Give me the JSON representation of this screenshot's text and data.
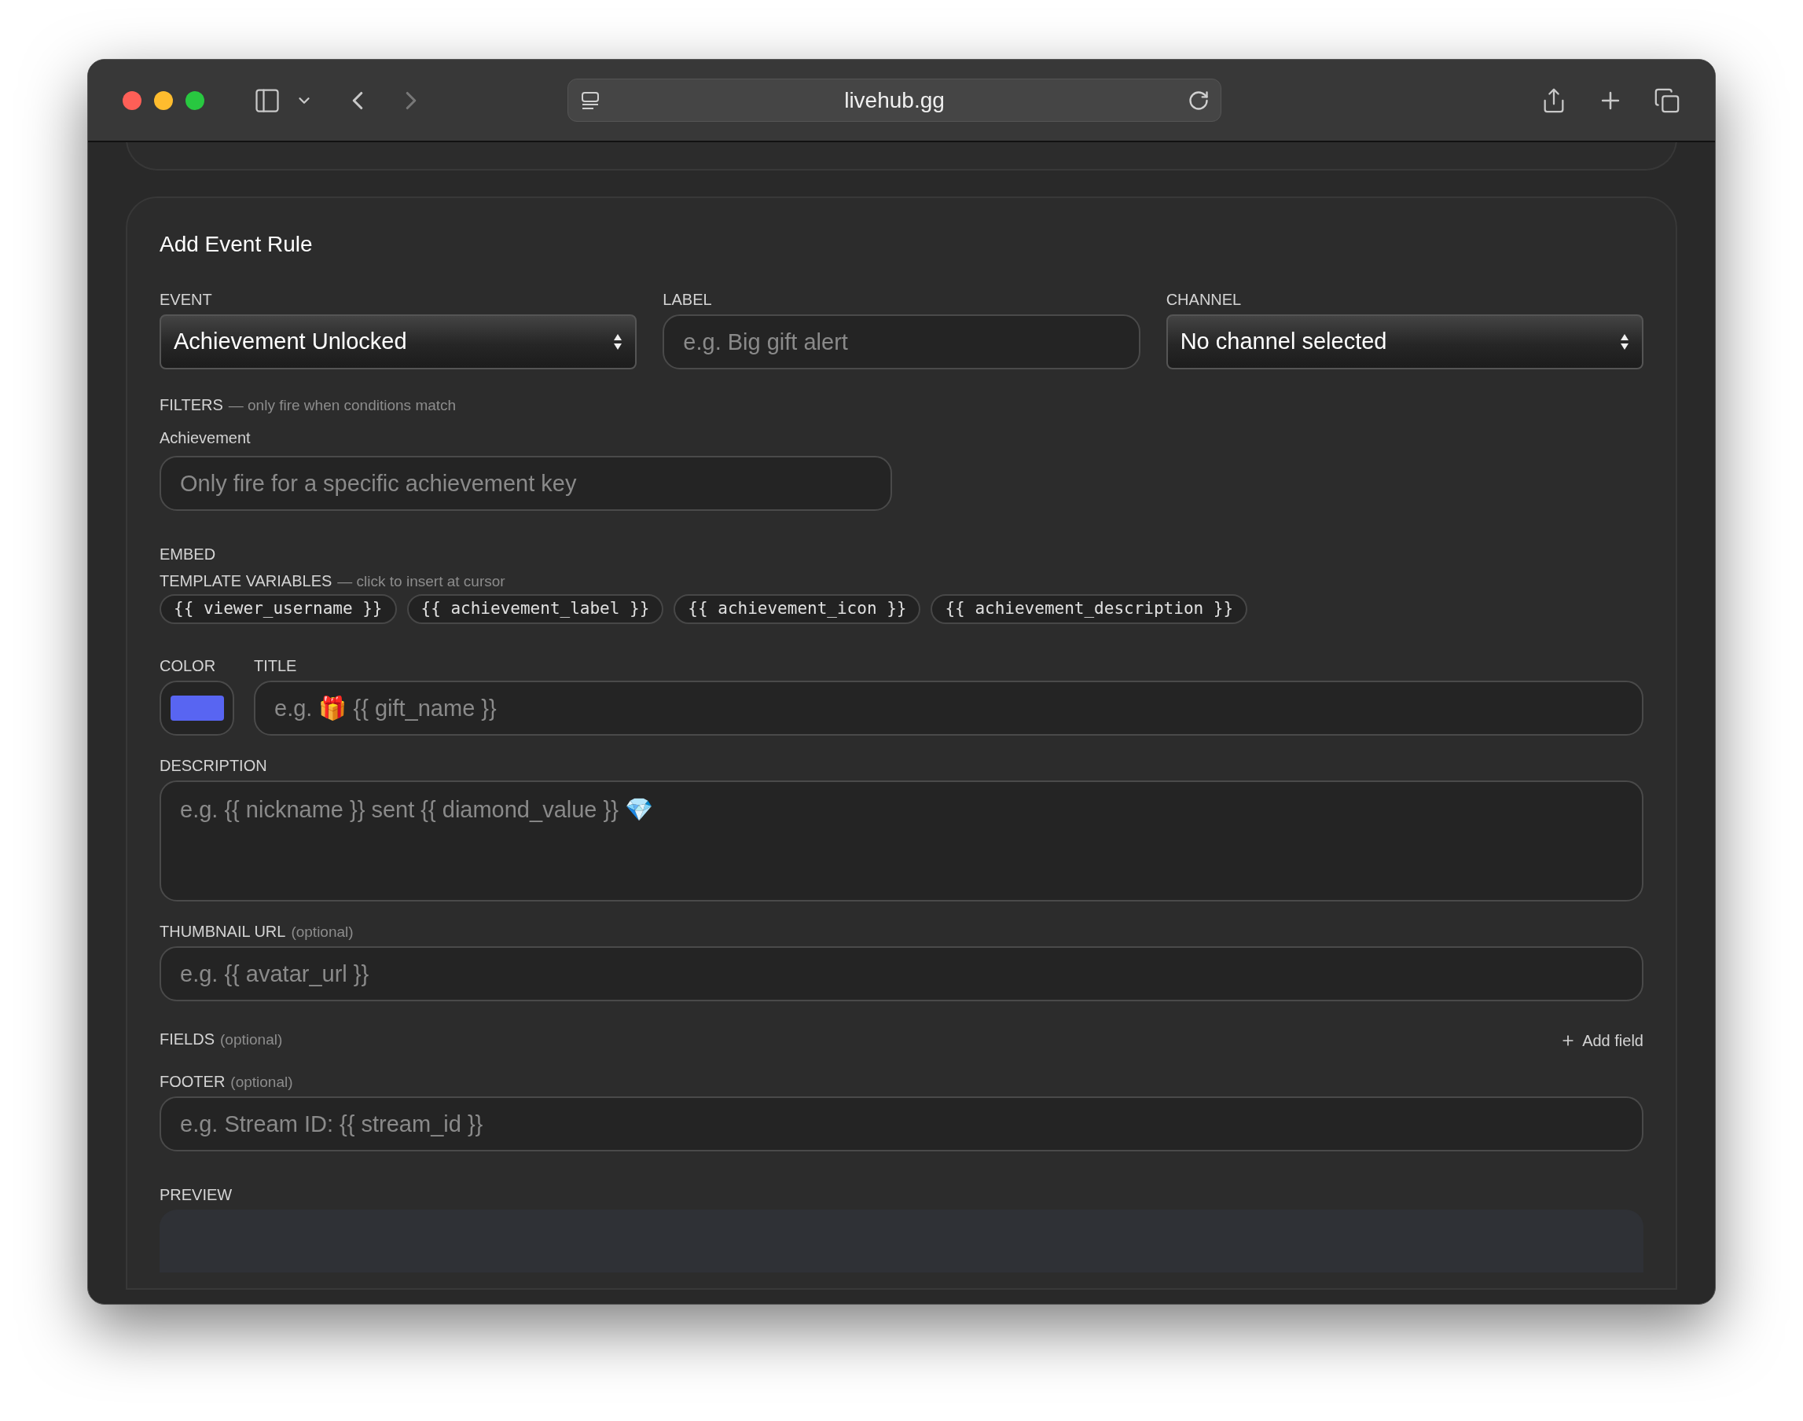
{
  "browser": {
    "url": "livehub.gg"
  },
  "form": {
    "title": "Add Event Rule",
    "event": {
      "label": "EVENT",
      "value": "Achievement Unlocked"
    },
    "label_field": {
      "label": "LABEL",
      "placeholder": "e.g. Big gift alert"
    },
    "channel": {
      "label": "CHANNEL",
      "value": "No channel selected"
    },
    "filters": {
      "heading": "FILTERS",
      "hint": "— only fire when conditions match",
      "fields": [
        {
          "label": "Achievement",
          "placeholder": "Only fire for a specific achievement key"
        }
      ]
    },
    "embed": {
      "heading": "EMBED",
      "template_variables": {
        "heading": "TEMPLATE VARIABLES",
        "hint": "— click to insert at cursor",
        "chips": [
          "{{ viewer_username }}",
          "{{ achievement_label }}",
          "{{ achievement_icon }}",
          "{{ achievement_description }}"
        ]
      },
      "color": {
        "label": "COLOR",
        "color": "#5865f2"
      },
      "title": {
        "label": "TITLE",
        "placeholder": "e.g. 🎁 {{ gift_name }}"
      },
      "description": {
        "label": "DESCRIPTION",
        "placeholder": "e.g. {{ nickname }} sent {{ diamond_value }} 💎"
      },
      "thumbnail": {
        "label": "THUMBNAIL URL",
        "hint": "(optional)",
        "placeholder": "e.g. {{ avatar_url }}"
      },
      "fields": {
        "label": "FIELDS",
        "hint": "(optional)",
        "add_button": "Add field"
      },
      "footer": {
        "label": "FOOTER",
        "hint": "(optional)",
        "placeholder": "e.g. Stream ID: {{ stream_id }}"
      }
    },
    "preview": {
      "heading": "PREVIEW"
    }
  }
}
